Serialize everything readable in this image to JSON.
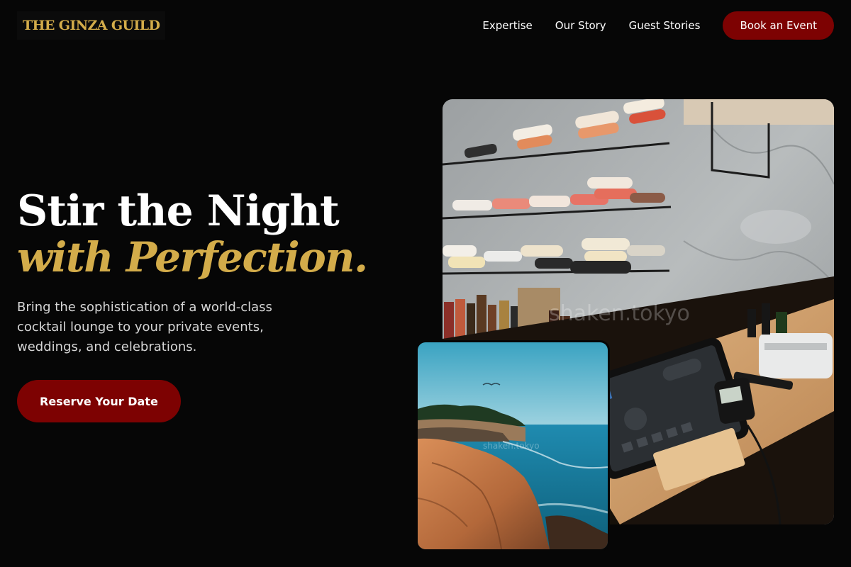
{
  "brand": {
    "name": "THE GINZA GUILD",
    "accent_color": "#d3ac4a",
    "cta_color": "#7d0202"
  },
  "nav": {
    "items": [
      {
        "label": "Expertise"
      },
      {
        "label": "Our Story"
      },
      {
        "label": "Guest Stories"
      }
    ],
    "cta_label": "Book an Event"
  },
  "hero": {
    "headline_line1": "Stir the Night",
    "headline_line2": "with Perfection.",
    "subcopy": "Bring the sophistication of a world-class cocktail lounge to your private events, weddings, and celebrations.",
    "cta_label": "Reserve Your Date"
  },
  "images": {
    "main_watermark": "shaken.tokyo",
    "inset_watermark": "shaken.tokyo"
  }
}
